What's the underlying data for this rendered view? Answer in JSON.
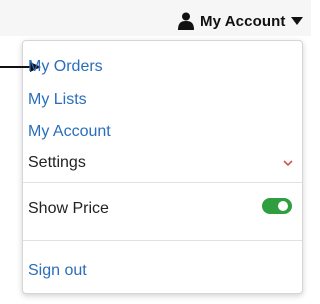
{
  "header": {
    "account_label": "My Account",
    "account_icon": "user-icon",
    "caret_icon": "caret-down-icon"
  },
  "menu": {
    "items": [
      {
        "label": "My Orders"
      },
      {
        "label": "My Lists"
      },
      {
        "label": "My Account"
      },
      {
        "label": "Settings"
      }
    ],
    "show_price": {
      "label": "Show Price",
      "enabled": true
    },
    "sign_out": {
      "label": "Sign out"
    }
  },
  "colors": {
    "link": "#2a6ebb",
    "toggle_on": "#2e9e3e",
    "settings_chevron": "#d9534f"
  }
}
